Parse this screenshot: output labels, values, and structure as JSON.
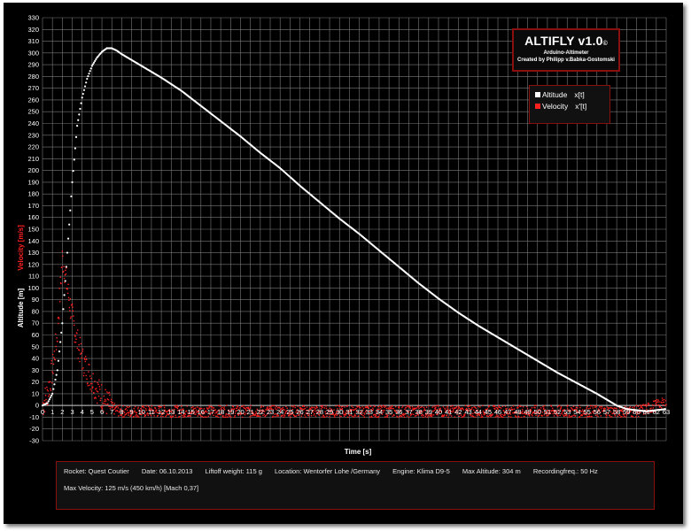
{
  "chart_data": {
    "type": "scatter",
    "xlabel": "Time [s]",
    "ylabel": "Altitude [m]",
    "y2label": "Velocity [m/s]",
    "xlim": [
      0,
      63
    ],
    "ylim": [
      -30,
      330
    ],
    "xticks": [
      "0",
      "1",
      "2",
      "3",
      "4",
      "5",
      "6",
      "7",
      "8",
      "9",
      "10",
      "11",
      "12",
      "13",
      "14",
      "15",
      "16",
      "17",
      "18",
      "19",
      "20",
      "21",
      "22",
      "23",
      "24",
      "25",
      "26",
      "27",
      "28",
      "29",
      "30",
      "31",
      "32",
      "33",
      "34",
      "35",
      "36",
      "37",
      "38",
      "39",
      "40",
      "41",
      "42",
      "43",
      "44",
      "45",
      "46",
      "47",
      "48",
      "49",
      "50",
      "51",
      "52",
      "53",
      "54",
      "55",
      "56",
      "57",
      "58",
      "59",
      "60",
      "61",
      "62",
      "63"
    ],
    "yticks": [
      "-30",
      "-20",
      "-10",
      "0",
      "10",
      "20",
      "30",
      "40",
      "50",
      "60",
      "70",
      "80",
      "90",
      "100",
      "110",
      "120",
      "130",
      "140",
      "150",
      "160",
      "170",
      "180",
      "190",
      "200",
      "210",
      "220",
      "230",
      "240",
      "250",
      "260",
      "270",
      "280",
      "290",
      "300",
      "310",
      "320",
      "330"
    ],
    "grid": true,
    "legend_position": "top-right",
    "series": [
      {
        "name": "Altitude",
        "var": "x[t]",
        "color": "#ffffff",
        "x": [
          0,
          0.5,
          1.0,
          1.5,
          2.0,
          2.5,
          3.0,
          3.5,
          4.0,
          4.5,
          5.0,
          5.5,
          6.0,
          6.5,
          7.0,
          7.5,
          8.0,
          9.0,
          10,
          12,
          14,
          16,
          18,
          20,
          22,
          24,
          26,
          28,
          30,
          32,
          34,
          36,
          38,
          40,
          42,
          44,
          46,
          48,
          50,
          52,
          54,
          56,
          58,
          59,
          60,
          61,
          62,
          63
        ],
        "y": [
          0,
          2,
          10,
          30,
          70,
          130,
          190,
          238,
          262,
          278,
          289,
          296,
          301,
          304,
          304,
          302,
          299,
          294,
          289,
          279,
          268,
          255,
          242,
          229,
          215,
          202,
          187,
          173,
          159,
          146,
          132,
          118,
          104,
          91,
          79,
          68,
          58,
          48,
          38,
          28,
          19,
          10,
          0,
          -3,
          -4,
          -5,
          -4,
          -3
        ]
      },
      {
        "name": "Velocity",
        "var": "x'[t]",
        "color": "#ff2020",
        "x": [
          0,
          0.5,
          1.0,
          1.5,
          1.8,
          2.0,
          2.2,
          2.5,
          3.0,
          3.5,
          4.0,
          4.5,
          5.0,
          5.5,
          6.0,
          6.5,
          7.0,
          7.5,
          8.0,
          10,
          15,
          20,
          25,
          30,
          35,
          40,
          45,
          50,
          55,
          60,
          61,
          62,
          63
        ],
        "y": [
          0,
          10,
          30,
          60,
          100,
          125,
          118,
          100,
          75,
          55,
          40,
          30,
          22,
          14,
          8,
          2,
          -2,
          -4,
          -5,
          -5,
          -5,
          -5,
          -5,
          -5,
          -5,
          -5,
          -5,
          -5,
          -5,
          -5,
          -3,
          0,
          2
        ]
      }
    ]
  },
  "brand": {
    "title": "ALTIFLY v1.0",
    "copyright": "©",
    "subtitle": "Arduino-Altimeter",
    "credit": "Created by Philipp v.Babka-Gostomski"
  },
  "info": {
    "rocket": "Rocket: Quest Coutier",
    "date": "Date: 06.10.2013",
    "weight": "Liftoff weight: 115 g",
    "location": "Location: Wentorfer Lohe /Germany",
    "engine": "Engine: Klima D9-5",
    "max_altitude": "Max Altitude:  304 m",
    "freq": "Recordingfreq.: 50 Hz",
    "max_velocity": "Max Velocity:  125 m/s (450 km/h) [Mach 0,37]"
  },
  "colors": {
    "background": "#000000",
    "grid": "#7a7a7a",
    "altitude": "#ffffff",
    "velocity": "#ff2020",
    "border": "#8a1010"
  }
}
